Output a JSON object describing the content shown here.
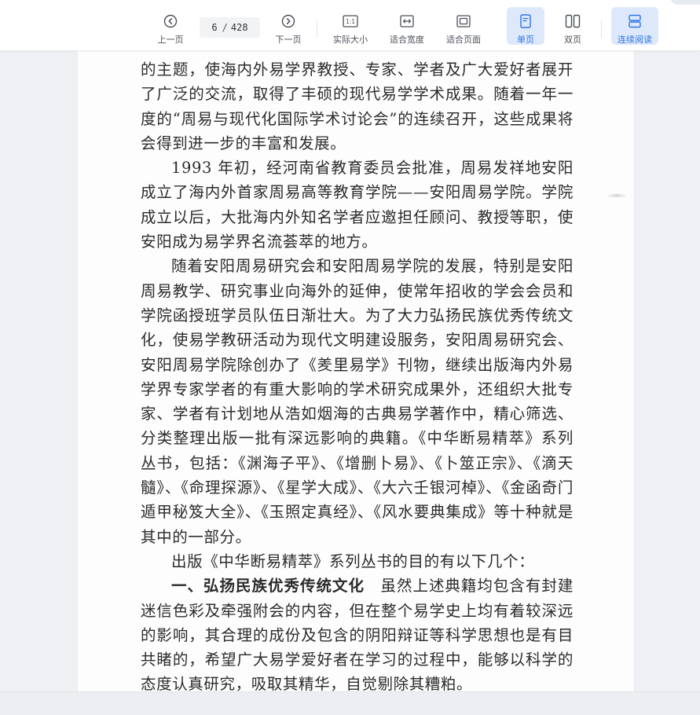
{
  "toolbar": {
    "prev_label": "上一页",
    "page_current": "6",
    "page_separator": "/",
    "page_total": "428",
    "next_label": "下一页",
    "actual_size_label": "实际大小",
    "fit_width_label": "适合宽度",
    "fit_page_label": "适合页面",
    "single_page_label": "单页",
    "double_page_label": "双页",
    "continuous_label": "连续阅读",
    "actual_size_icon_text": "1:1",
    "accent_color": "#2f76e6",
    "active_bg": "#dde9fb"
  },
  "icons": {
    "prev": "circle-left-chevron-icon",
    "next": "circle-right-chevron-icon",
    "actual_size": "one-to-one-icon",
    "fit_width": "fit-width-arrows-icon",
    "fit_page": "fit-page-icon",
    "single_page": "single-page-icon",
    "double_page": "double-page-icon",
    "continuous": "continuous-scroll-icon"
  },
  "document": {
    "p1": "的主题，使海内外易学界教授、专家、学者及广大爱好者展开了广泛的交流，取得了丰硕的现代易学学术成果。随着一年一度的“周易与现代化国际学术讨论会”的连续召开，这些成果将会得到进一步的丰富和发展。",
    "p2": "1993 年初，经河南省教育委员会批准，周易发祥地安阳成立了海内外首家周易高等教育学院——安阳周易学院。学院成立以后，大批海内外知名学者应邀担任顾问、教授等职，使安阳成为易学界名流荟萃的地方。",
    "p3": "随着安阳周易研究会和安阳周易学院的发展，特别是安阳周易教学、研究事业向海外的延伸，使常年招收的学会会员和学院函授班学员队伍日渐壮大。为了大力弘扬民族优秀传统文化，使易学教研活动为现代文明建设服务，安阳周易研究会、安阳周易学院除创办了《羑里易学》刊物，继续出版海内外易学界专家学者的有重大影响的学术研究成果外，还组织大批专家、学者有计划地从浩如烟海的古典易学著作中，精心筛选、分类整理出版一批有深远影响的典籍。《中华断易精萃》系列丛书，包括：《渊海子平》、《增删卜易》、《卜筮正宗》、《滴天髓》、《命理探源》、《星学大成》、《大六壬银河棹》、《金函奇门遁甲秘笈大全》、《玉照定真经》、《风水要典集成》等十种就是其中的一部分。",
    "p4": "出版《中华断易精萃》系列丛书的目的有以下几个：",
    "p5_lead": "一、弘扬民族优秀传统文化",
    "p5_body": "虽然上述典籍均包含有封建迷信色彩及牵强附会的内容，但在整个易学史上均有着较深远的影响，其合理的成份及包含的阴阳辩证等科学思想也是有目共睹的，希望广大易学爱好者在学习的过程中，能够以科学的态度认真研究，吸取其精华，自觉剔除其糟粕。"
  }
}
